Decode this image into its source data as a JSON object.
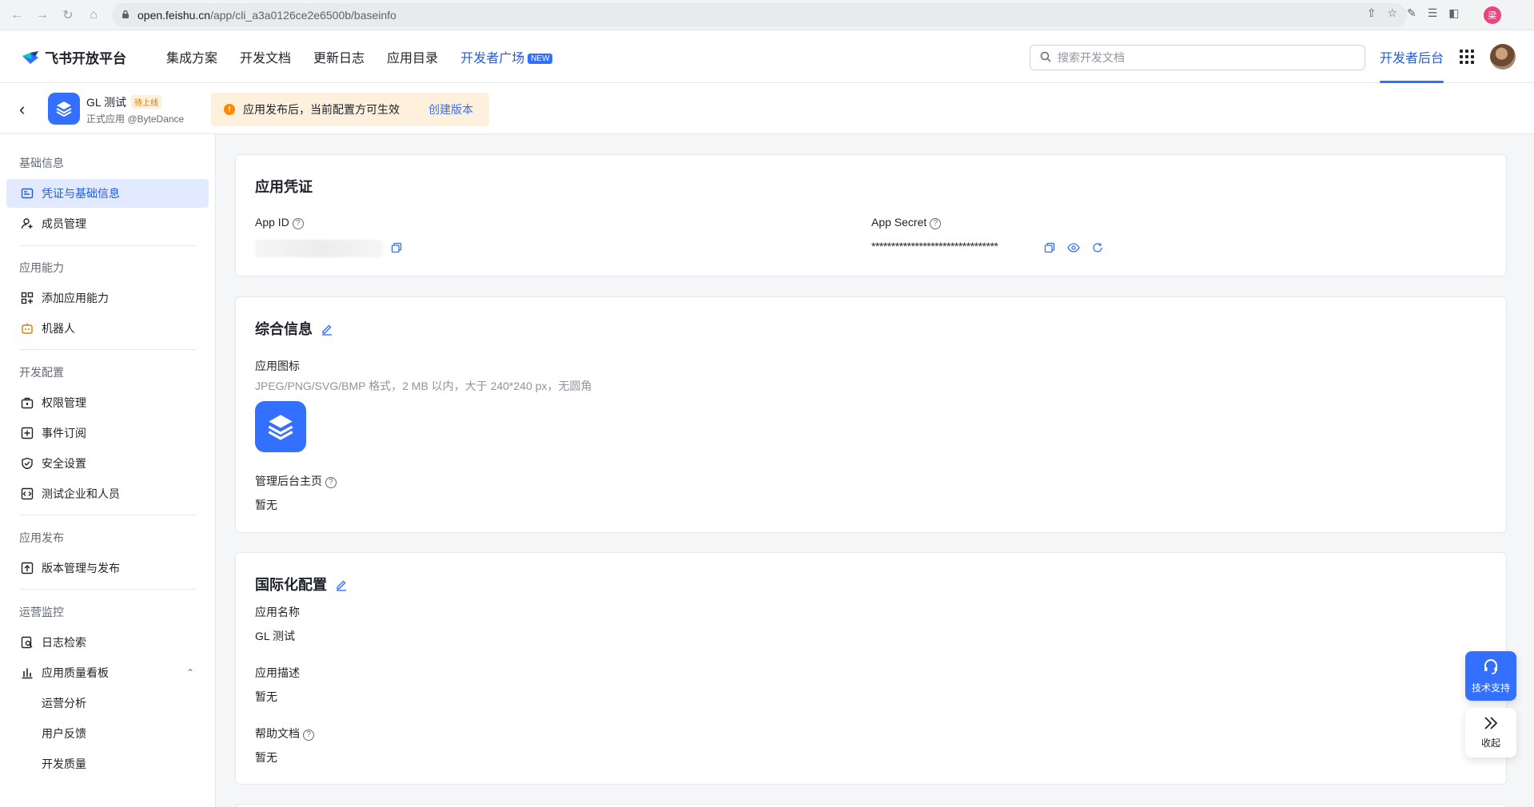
{
  "browser": {
    "url_host": "open.feishu.cn",
    "url_path": "/app/cli_a3a0126ce2e6500b/baseinfo",
    "profile_initial": "梁"
  },
  "topnav": {
    "brand": "飞书开放平台",
    "links": [
      "集成方案",
      "开发文档",
      "更新日志",
      "应用目录"
    ],
    "highlight_link": "开发者广场",
    "new_badge": "NEW",
    "search_placeholder": "搜索开发文档",
    "console": "开发者后台"
  },
  "app": {
    "name": "GL 测试",
    "status": "待上线",
    "subtitle": "正式应用 @ByteDance",
    "notice": "应用发布后，当前配置方可生效",
    "notice_link": "创建版本"
  },
  "sidebar": {
    "groups": [
      {
        "title": "基础信息",
        "items": [
          "凭证与基础信息",
          "成员管理"
        ]
      },
      {
        "title": "应用能力",
        "items": [
          "添加应用能力",
          "机器人"
        ]
      },
      {
        "title": "开发配置",
        "items": [
          "权限管理",
          "事件订阅",
          "安全设置",
          "测试企业和人员"
        ]
      },
      {
        "title": "应用发布",
        "items": [
          "版本管理与发布"
        ]
      },
      {
        "title": "运营监控",
        "items": [
          "日志检索",
          "应用质量看板"
        ]
      }
    ],
    "sub_items": [
      "运营分析",
      "用户反馈",
      "开发质量"
    ]
  },
  "credentials": {
    "title": "应用凭证",
    "app_id_label": "App ID",
    "app_secret_label": "App Secret",
    "app_secret_value": "********************************"
  },
  "general": {
    "title": "综合信息",
    "icon_label": "应用图标",
    "icon_hint": "JPEG/PNG/SVG/BMP 格式，2 MB 以内，大于 240*240 px，无圆角",
    "admin_home_label": "管理后台主页",
    "admin_home_value": "暂无"
  },
  "i18n": {
    "title": "国际化配置",
    "name_label": "应用名称",
    "name_value": "GL 测试",
    "desc_label": "应用描述",
    "desc_value": "暂无",
    "help_label": "帮助文档",
    "help_value": "暂无"
  },
  "floating": {
    "support": "技术支持",
    "collapse": "收起"
  },
  "colors": {
    "primary": "#3370ff",
    "active_bg": "#e1eaff",
    "notice_bg": "#fdf0dd",
    "warn": "#ff8800"
  }
}
